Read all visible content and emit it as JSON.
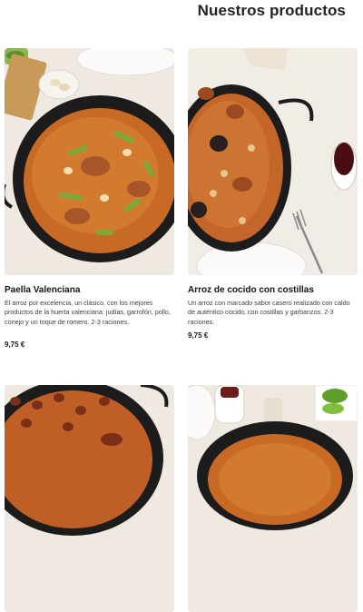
{
  "section": {
    "title": "Nuestros productos"
  },
  "products": [
    {
      "name": "Paella Valenciana",
      "description": "El arroz por excelencia, un clásico, con los mejores productos de la huerta valenciana: judías, garrofón, pollo, conejo y un toque de romero. 2-3 raciones.",
      "price": "9,75 €",
      "image": "paella-valenciana-photo"
    },
    {
      "name": "Arroz de cocido con costillas",
      "description": "Un arroz con marcado sabor casero realizado con caldo de auténtico cocido, con costillas y garbanzos. 2-3 raciones.",
      "price": "9,75 €",
      "image": "arroz-cocido-photo"
    },
    {
      "image": "paella-photo-3"
    },
    {
      "image": "paella-photo-4"
    }
  ],
  "colors": {
    "pan": "#1c1c1c",
    "rice": "#c86a26",
    "table": "#f1ece6",
    "green": "#7fa83a"
  }
}
